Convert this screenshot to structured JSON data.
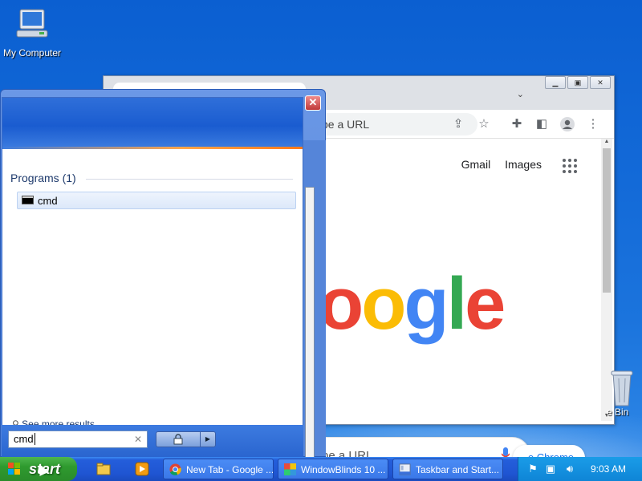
{
  "desktop": {
    "icons": [
      {
        "label": "My Computer",
        "icon": "my-computer-icon"
      },
      {
        "label": "e Bin",
        "icon": "recycle-bin-icon"
      }
    ]
  },
  "chrome": {
    "omnibox_placeholder": "pe a URL",
    "top_links": [
      "Gmail",
      "Images"
    ],
    "logo_text": "oogle",
    "search_placeholder": "pe a URL",
    "customize_label": "e Chrome",
    "icons": [
      "share-icon",
      "bookmark-star-icon",
      "extensions-icon",
      "side-panel-icon",
      "profile-icon",
      "menu-icon",
      "apps-icon",
      "mic-icon"
    ]
  },
  "startmenu": {
    "programs_header": "Programs (1)",
    "results": [
      {
        "label": "cmd",
        "icon": "cmd-icon"
      }
    ],
    "see_more": "See more results",
    "search_value": "cmd",
    "close_glyph": "✕"
  },
  "taskbar": {
    "start_label": "start",
    "tasks": [
      {
        "label": "New Tab - Google ...",
        "icon": "chrome-icon"
      },
      {
        "label": "WindowBlinds 10 ...",
        "icon": "windowblinds-icon"
      },
      {
        "label": "Taskbar and Start...",
        "icon": "taskbar-settings-icon"
      }
    ],
    "clock": "9:03 AM"
  },
  "colors": {
    "desktop_blue": "#1565c7",
    "start_green": "#2f9a2f",
    "taskbar_blue": "#245edb",
    "google_blue": "#4285f4",
    "google_red": "#ea4335",
    "google_yellow": "#fbbc05",
    "google_green": "#34a853"
  }
}
